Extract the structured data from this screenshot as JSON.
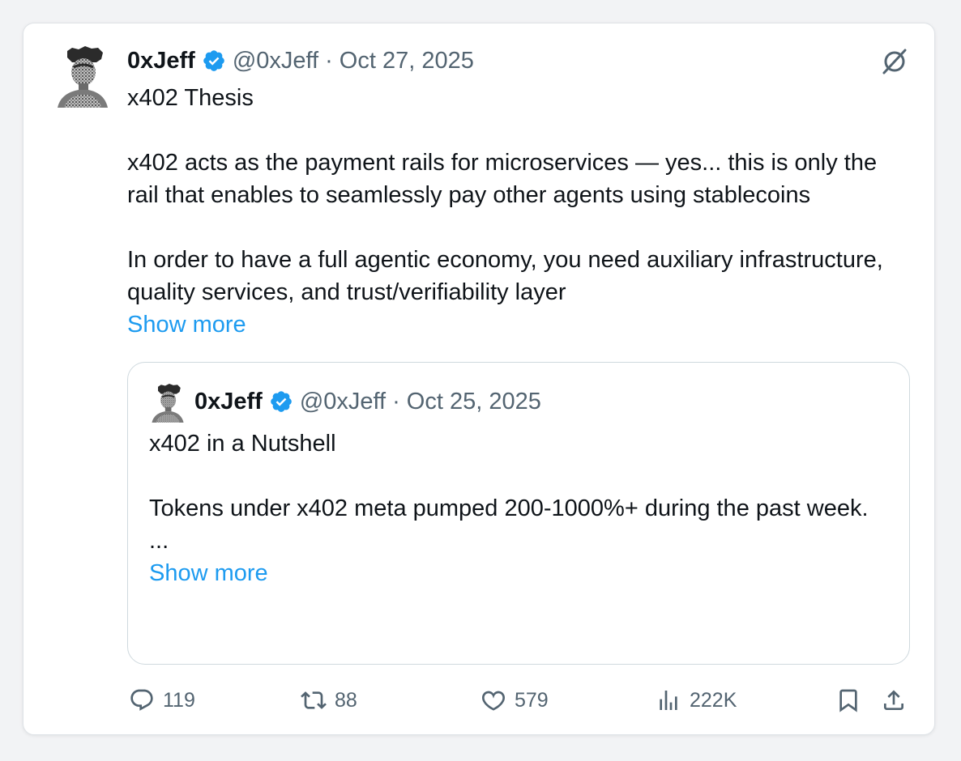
{
  "post": {
    "author": {
      "name": "0xJeff",
      "handle": "@0xJeff",
      "verified_icon": "verified-badge-icon",
      "avatar_icon": "avatar-image"
    },
    "separator": "·",
    "date": "Oct 27, 2025",
    "text": {
      "title": "x402 Thesis",
      "para1": "x402 acts as the payment rails for microservices — yes... this is only the rail that enables to seamlessly pay other agents using stablecoins",
      "para2": "In order to have a full agentic economy, you need auxiliary infrastructure, quality services, and trust/verifiability layer"
    },
    "show_more": "Show more",
    "grok_icon": "grok-icon"
  },
  "quote": {
    "author": {
      "name": "0xJeff",
      "handle": "@0xJeff"
    },
    "separator": "·",
    "date": "Oct 25, 2025",
    "text": {
      "title": "x402 in a Nutshell",
      "para1": "Tokens under x402 meta pumped 200-1000%+ during the past week.",
      "ellipsis": "..."
    },
    "show_more": "Show more"
  },
  "actions": {
    "replies": "119",
    "reposts": "88",
    "likes": "579",
    "views": "222K"
  },
  "colors": {
    "accent": "#1d9bf0",
    "secondary_text": "#536471",
    "primary_text": "#0f1419",
    "border": "#cfd9de"
  }
}
